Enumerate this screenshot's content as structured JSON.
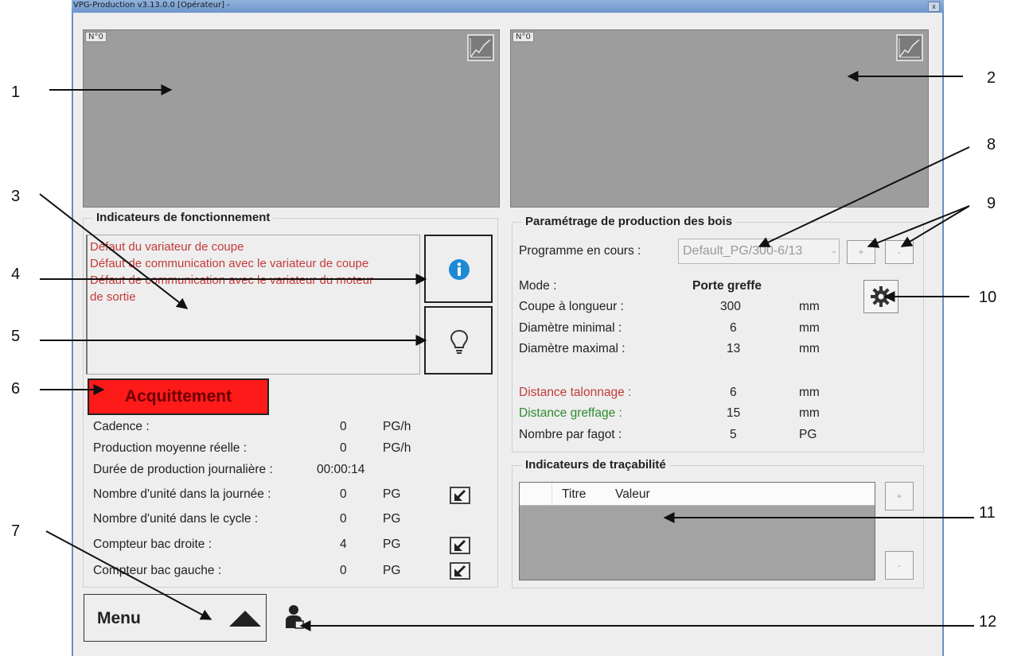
{
  "window": {
    "title": "VPG-Production v3.13.0.0 [Opérateur] -",
    "close": "x"
  },
  "graphs": [
    {
      "label": "N°0"
    },
    {
      "label": "N°0"
    }
  ],
  "indicators": {
    "title": "Indicateurs de fonctionnement",
    "messages": [
      "Défaut du variateur de coupe",
      "Défaut de communication avec le variateur de coupe",
      "Défaut de communication avec le variateur du moteur",
      "de sortie"
    ],
    "ack": "Acquittement"
  },
  "stats": [
    {
      "label": "Cadence :",
      "value": "0",
      "unit": "PG/h",
      "has_btn": false
    },
    {
      "label": "Production moyenne réelle :",
      "value": "0",
      "unit": "PG/h",
      "has_btn": false
    },
    {
      "label": "Durée de production journalière :",
      "value": "00:00:14",
      "unit": "",
      "has_btn": false
    },
    {
      "label": "Nombre d'unité dans la journée :",
      "value": "0",
      "unit": "PG",
      "has_btn": true
    },
    {
      "label": "Nombre d'unité dans le cycle :",
      "value": "0",
      "unit": "PG",
      "has_btn": false
    },
    {
      "label": "Compteur bac droite :",
      "value": "4",
      "unit": "PG",
      "has_btn": true
    },
    {
      "label": "Compteur bac gauche :",
      "value": "0",
      "unit": "PG",
      "has_btn": true
    }
  ],
  "params": {
    "title": "Paramétrage de production des bois",
    "program_label": "Programme en cours :",
    "program_value": "Default_PG/300-6/13",
    "plus": "+",
    "minus": "-",
    "rows": [
      {
        "label": "Mode :",
        "value": "Porte greffe",
        "unit": "",
        "color": "#222222",
        "bold": true
      },
      {
        "label": "Coupe à longueur :",
        "value": "300",
        "unit": "mm",
        "color": "#222222",
        "bold": false
      },
      {
        "label": "Diamètre minimal :",
        "value": "6",
        "unit": "mm",
        "color": "#222222",
        "bold": false
      },
      {
        "label": "Diamètre maximal :",
        "value": "13",
        "unit": "mm",
        "color": "#222222",
        "bold": false
      },
      {
        "label": "Distance talonnage :",
        "value": "6",
        "unit": "mm",
        "color": "#c43a3a",
        "bold": false
      },
      {
        "label": "Distance greffage :",
        "value": "15",
        "unit": "mm",
        "color": "#2f8a2f",
        "bold": false
      },
      {
        "label": "Nombre par fagot :",
        "value": "5",
        "unit": "PG",
        "color": "#222222",
        "bold": false
      }
    ]
  },
  "trace": {
    "title": "Indicateurs de traçabilité",
    "col_title": "Titre",
    "col_value": "Valeur",
    "plus": "+",
    "minus": "-"
  },
  "menu": {
    "label": "Menu"
  },
  "annotations": [
    "1",
    "2",
    "3",
    "4",
    "5",
    "6",
    "7",
    "8",
    "9",
    "10",
    "11",
    "12"
  ]
}
